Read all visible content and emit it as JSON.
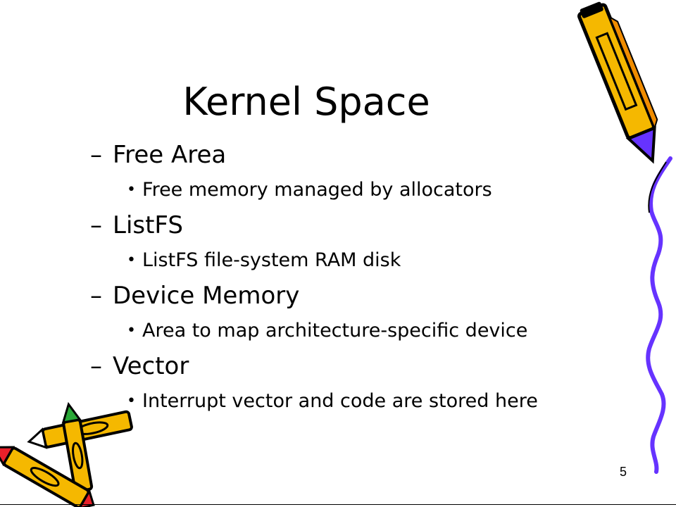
{
  "slide": {
    "title": "Kernel Space",
    "page_number": "5",
    "bullets": [
      {
        "dash": "–",
        "label": "Free Area",
        "sub_bullet": "•",
        "sub": "Free memory managed by allocators"
      },
      {
        "dash": "–",
        "label": "ListFS",
        "sub_bullet": "•",
        "sub": "ListFS file-system RAM disk"
      },
      {
        "dash": "–",
        "label": "Device Memory",
        "sub_bullet": "•",
        "sub": "Area to map architecture-specific device"
      },
      {
        "dash": "–",
        "label": "Vector",
        "sub_bullet": "•",
        "sub": "Interrupt vector and code are stored here"
      }
    ]
  },
  "decorations": {
    "top_right": "pencil-icon",
    "bottom_left": "crayons-icon",
    "right_edge": "squiggle-line",
    "pencil_colors": {
      "body": "#f5b800",
      "outline": "#000000",
      "tip_purple": "#6633ff",
      "red": "#e8202a",
      "green": "#2aa838"
    }
  }
}
